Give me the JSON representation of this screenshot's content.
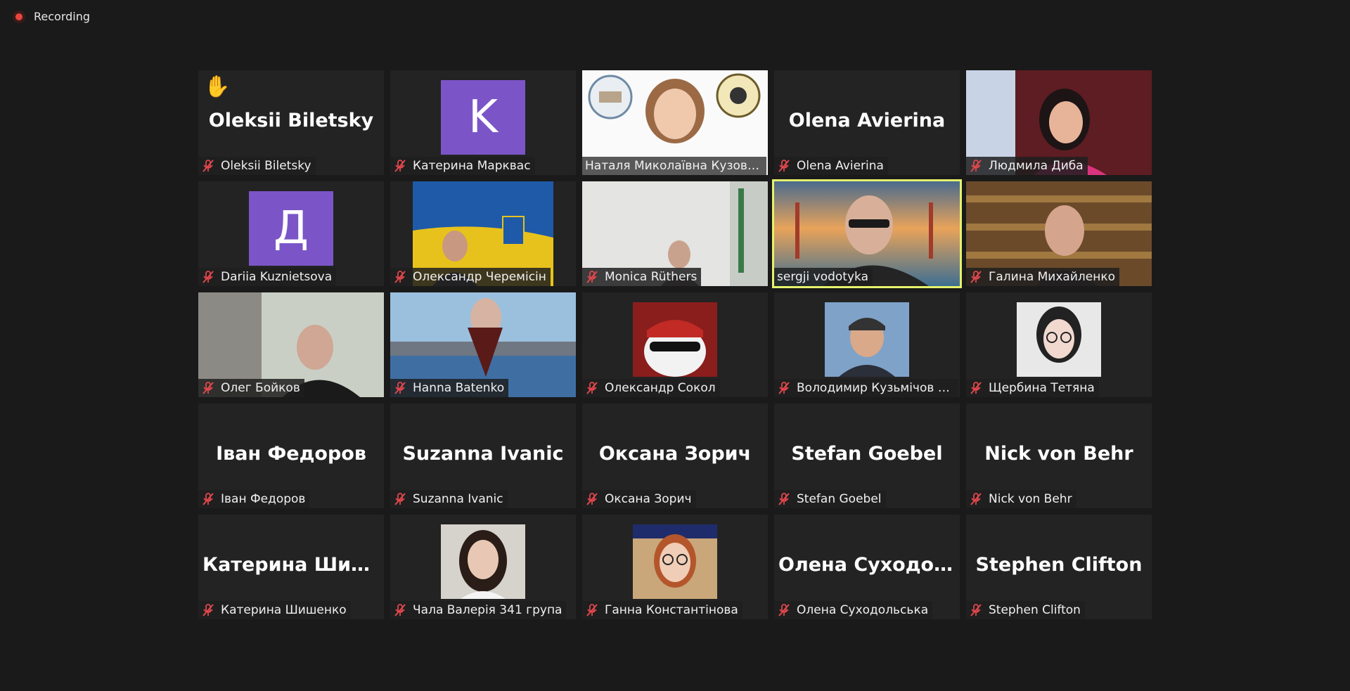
{
  "recording": {
    "label": "Recording"
  },
  "tiles": [
    {
      "name": "Oleksii Biletsky",
      "big": "Oleksii Biletsky",
      "hand": "✋"
    },
    {
      "name": "Катерина Марквас",
      "avatar": "K"
    },
    {
      "name": "Наталя Миколаївна Кузово..."
    },
    {
      "name": "Olena Avierina",
      "big": "Olena Avierina"
    },
    {
      "name": "Людмила Диба"
    },
    {
      "name": "Dariia Kuznietsova",
      "avatar": "Д"
    },
    {
      "name": "Олександр Черемісін"
    },
    {
      "name": "Monica Rüthers"
    },
    {
      "name": "sergji vodotyka"
    },
    {
      "name": "Галина Михайленко"
    },
    {
      "name": "Олег Бойков"
    },
    {
      "name": "Hanna Batenko"
    },
    {
      "name": "Олександр Сокол"
    },
    {
      "name": "Володимир Кузьмічов (4..."
    },
    {
      "name": "Щербина Тетяна"
    },
    {
      "name": "Іван Федоров",
      "big": "Іван Федоров"
    },
    {
      "name": "Suzanna Ivanic",
      "big": "Suzanna Ivanic"
    },
    {
      "name": "Оксана Зорич",
      "big": "Оксана Зорич"
    },
    {
      "name": "Stefan Goebel",
      "big": "Stefan Goebel"
    },
    {
      "name": "Nick von Behr",
      "big": "Nick von Behr"
    },
    {
      "name": "Катерина Шишенко",
      "big": "Катерина Шиш..."
    },
    {
      "name": "Чала Валерія 341 група"
    },
    {
      "name": "Ганна Константінова"
    },
    {
      "name": "Олена Суходольська",
      "big": "Олена Суходол..."
    },
    {
      "name": "Stephen Clifton",
      "big": "Stephen Clifton"
    }
  ],
  "colors": {
    "active_border": "#e6f26b",
    "avatar_bg": "#7b55c8",
    "mute_red": "#e0474c"
  }
}
